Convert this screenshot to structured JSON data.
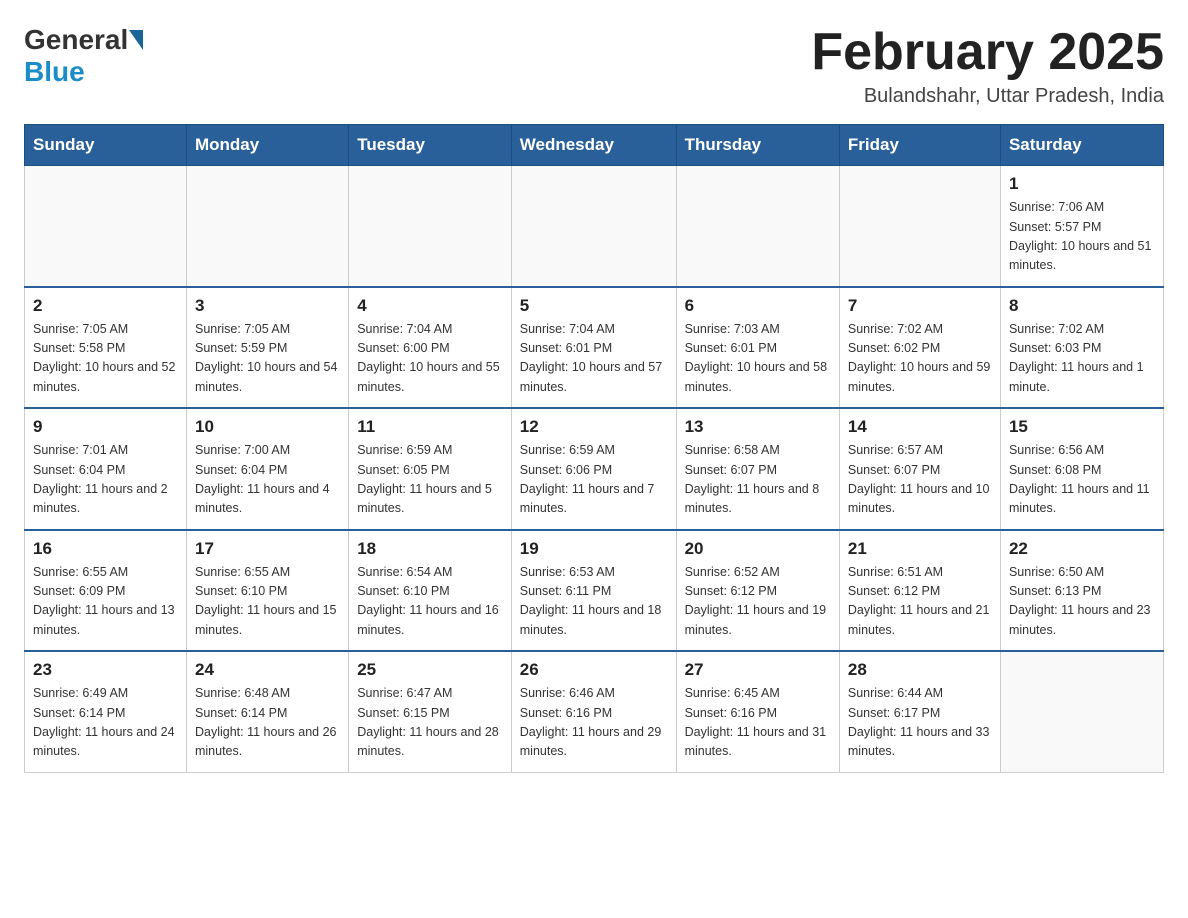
{
  "header": {
    "logo": {
      "general": "General",
      "blue": "Blue"
    },
    "title": "February 2025",
    "location": "Bulandshahr, Uttar Pradesh, India"
  },
  "weekdays": [
    "Sunday",
    "Monday",
    "Tuesday",
    "Wednesday",
    "Thursday",
    "Friday",
    "Saturday"
  ],
  "weeks": [
    [
      {
        "day": "",
        "info": ""
      },
      {
        "day": "",
        "info": ""
      },
      {
        "day": "",
        "info": ""
      },
      {
        "day": "",
        "info": ""
      },
      {
        "day": "",
        "info": ""
      },
      {
        "day": "",
        "info": ""
      },
      {
        "day": "1",
        "info": "Sunrise: 7:06 AM\nSunset: 5:57 PM\nDaylight: 10 hours and 51 minutes."
      }
    ],
    [
      {
        "day": "2",
        "info": "Sunrise: 7:05 AM\nSunset: 5:58 PM\nDaylight: 10 hours and 52 minutes."
      },
      {
        "day": "3",
        "info": "Sunrise: 7:05 AM\nSunset: 5:59 PM\nDaylight: 10 hours and 54 minutes."
      },
      {
        "day": "4",
        "info": "Sunrise: 7:04 AM\nSunset: 6:00 PM\nDaylight: 10 hours and 55 minutes."
      },
      {
        "day": "5",
        "info": "Sunrise: 7:04 AM\nSunset: 6:01 PM\nDaylight: 10 hours and 57 minutes."
      },
      {
        "day": "6",
        "info": "Sunrise: 7:03 AM\nSunset: 6:01 PM\nDaylight: 10 hours and 58 minutes."
      },
      {
        "day": "7",
        "info": "Sunrise: 7:02 AM\nSunset: 6:02 PM\nDaylight: 10 hours and 59 minutes."
      },
      {
        "day": "8",
        "info": "Sunrise: 7:02 AM\nSunset: 6:03 PM\nDaylight: 11 hours and 1 minute."
      }
    ],
    [
      {
        "day": "9",
        "info": "Sunrise: 7:01 AM\nSunset: 6:04 PM\nDaylight: 11 hours and 2 minutes."
      },
      {
        "day": "10",
        "info": "Sunrise: 7:00 AM\nSunset: 6:04 PM\nDaylight: 11 hours and 4 minutes."
      },
      {
        "day": "11",
        "info": "Sunrise: 6:59 AM\nSunset: 6:05 PM\nDaylight: 11 hours and 5 minutes."
      },
      {
        "day": "12",
        "info": "Sunrise: 6:59 AM\nSunset: 6:06 PM\nDaylight: 11 hours and 7 minutes."
      },
      {
        "day": "13",
        "info": "Sunrise: 6:58 AM\nSunset: 6:07 PM\nDaylight: 11 hours and 8 minutes."
      },
      {
        "day": "14",
        "info": "Sunrise: 6:57 AM\nSunset: 6:07 PM\nDaylight: 11 hours and 10 minutes."
      },
      {
        "day": "15",
        "info": "Sunrise: 6:56 AM\nSunset: 6:08 PM\nDaylight: 11 hours and 11 minutes."
      }
    ],
    [
      {
        "day": "16",
        "info": "Sunrise: 6:55 AM\nSunset: 6:09 PM\nDaylight: 11 hours and 13 minutes."
      },
      {
        "day": "17",
        "info": "Sunrise: 6:55 AM\nSunset: 6:10 PM\nDaylight: 11 hours and 15 minutes."
      },
      {
        "day": "18",
        "info": "Sunrise: 6:54 AM\nSunset: 6:10 PM\nDaylight: 11 hours and 16 minutes."
      },
      {
        "day": "19",
        "info": "Sunrise: 6:53 AM\nSunset: 6:11 PM\nDaylight: 11 hours and 18 minutes."
      },
      {
        "day": "20",
        "info": "Sunrise: 6:52 AM\nSunset: 6:12 PM\nDaylight: 11 hours and 19 minutes."
      },
      {
        "day": "21",
        "info": "Sunrise: 6:51 AM\nSunset: 6:12 PM\nDaylight: 11 hours and 21 minutes."
      },
      {
        "day": "22",
        "info": "Sunrise: 6:50 AM\nSunset: 6:13 PM\nDaylight: 11 hours and 23 minutes."
      }
    ],
    [
      {
        "day": "23",
        "info": "Sunrise: 6:49 AM\nSunset: 6:14 PM\nDaylight: 11 hours and 24 minutes."
      },
      {
        "day": "24",
        "info": "Sunrise: 6:48 AM\nSunset: 6:14 PM\nDaylight: 11 hours and 26 minutes."
      },
      {
        "day": "25",
        "info": "Sunrise: 6:47 AM\nSunset: 6:15 PM\nDaylight: 11 hours and 28 minutes."
      },
      {
        "day": "26",
        "info": "Sunrise: 6:46 AM\nSunset: 6:16 PM\nDaylight: 11 hours and 29 minutes."
      },
      {
        "day": "27",
        "info": "Sunrise: 6:45 AM\nSunset: 6:16 PM\nDaylight: 11 hours and 31 minutes."
      },
      {
        "day": "28",
        "info": "Sunrise: 6:44 AM\nSunset: 6:17 PM\nDaylight: 11 hours and 33 minutes."
      },
      {
        "day": "",
        "info": ""
      }
    ]
  ]
}
